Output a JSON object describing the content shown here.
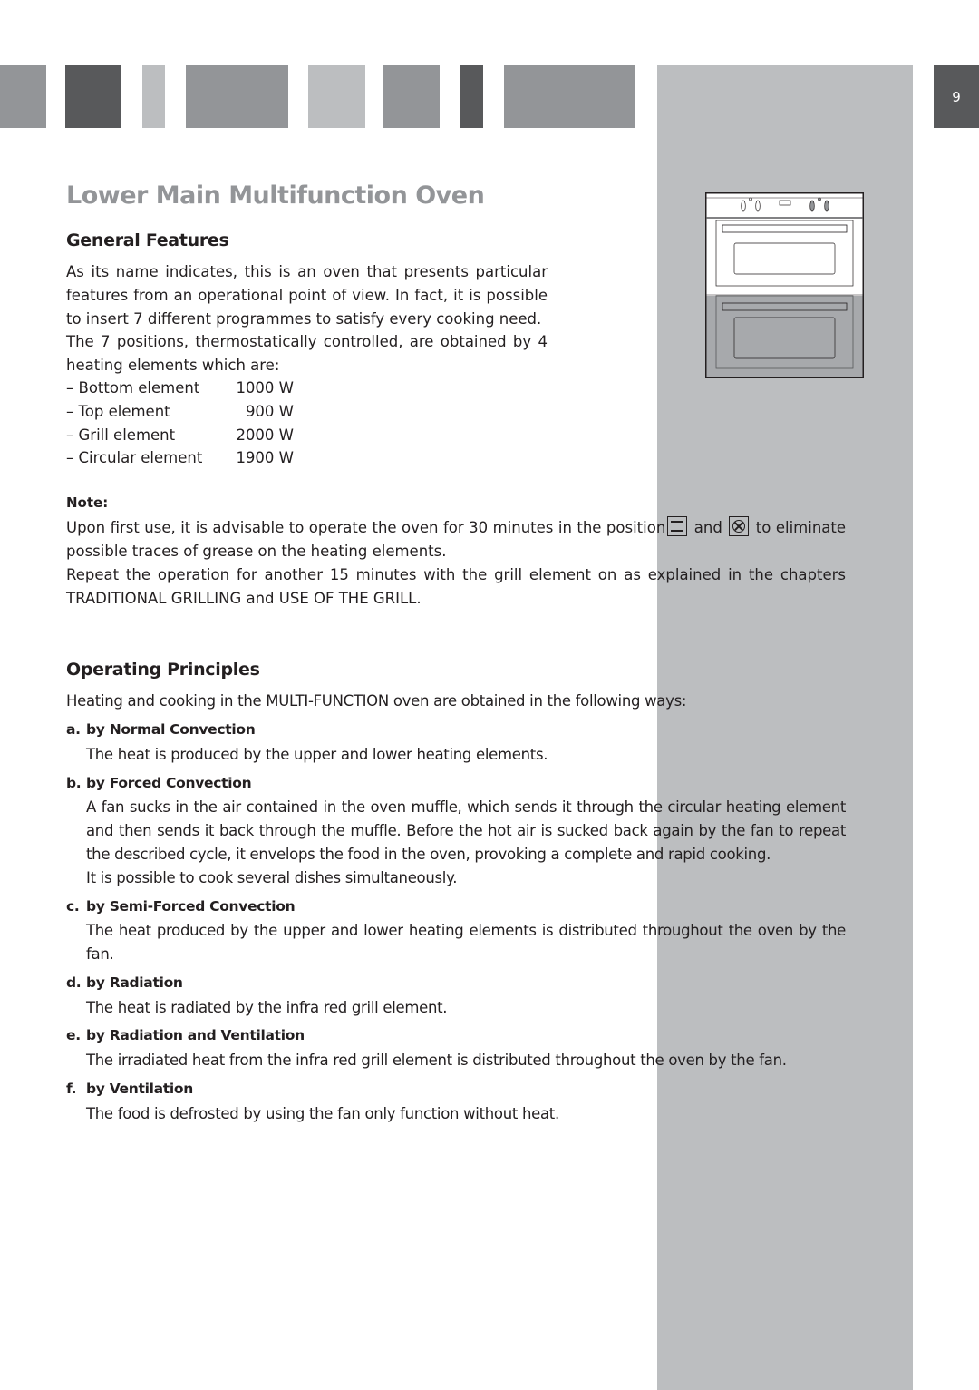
{
  "header": {
    "page_number": "9",
    "blocks": [
      {
        "name": "header-block-1",
        "tone": "mid"
      },
      {
        "name": "header-block-2",
        "tone": "dark"
      },
      {
        "name": "header-block-3",
        "tone": "light"
      },
      {
        "name": "header-block-4",
        "tone": "mid"
      },
      {
        "name": "header-block-5",
        "tone": "light"
      },
      {
        "name": "header-block-6",
        "tone": "mid"
      },
      {
        "name": "header-block-7",
        "tone": "dark"
      },
      {
        "name": "header-block-8",
        "tone": "mid"
      }
    ]
  },
  "colors": {
    "title_gray": "#939598",
    "dark_gray": "#58595b",
    "light_gray": "#bcbec0",
    "text": "#231f20"
  },
  "page": {
    "title": "Lower Main Multifunction Oven",
    "general_features": {
      "heading": "General Features",
      "intro_1": "As its name indicates, this is an oven that presents particular features from an operational point of view. In fact, it is possible to insert 7 different programmes to satisfy every cooking need.",
      "intro_2": "The 7 positions, thermostatically controlled, are obtained by 4 heating elements which are:",
      "elements": [
        {
          "name": "– Bottom element",
          "power": "1000 W"
        },
        {
          "name": "– Top element",
          "power": "900 W"
        },
        {
          "name": "– Grill element",
          "power": "2000 W"
        },
        {
          "name": "– Circular element",
          "power": "1900 W"
        }
      ]
    },
    "note": {
      "label": "Note:",
      "text_before_icons": "Upon first use, it is advisable to operate the oven for 30 minutes in the position",
      "icon_1": "top-bottom-heat-icon",
      "and": "and",
      "icon_2": "fan-icon",
      "text_after_icons": "to eliminate possible traces of grease on the heating elements.",
      "repeat": "Repeat the operation for another 15 minutes with the grill element on as explained in the chapters TRADITIONAL GRILLING and USE OF THE GRILL."
    },
    "operating_principles": {
      "heading": "Operating Principles",
      "intro": "Heating and cooking in the MULTI-FUNCTION oven are obtained in the following ways:",
      "methods": [
        {
          "letter": "a.",
          "title": "by Normal Convection",
          "body": [
            "The heat is produced by the upper and lower heating elements."
          ]
        },
        {
          "letter": "b.",
          "title": "by Forced Convection",
          "body": [
            "A fan sucks in the air contained in the oven muffle, which sends it through the circular heating element and then sends it back through the muffle. Before the hot air is sucked back again by the fan to repeat the described cycle, it envelops the food in the oven, provoking a complete and rapid cooking.",
            "It is possible to cook several dishes simultaneously."
          ]
        },
        {
          "letter": "c.",
          "title": "by Semi-Forced Convection",
          "body": [
            "The heat produced by the upper and lower heating elements is distributed throughout the oven by the fan."
          ]
        },
        {
          "letter": "d.",
          "title": "by Radiation",
          "body": [
            "The heat is radiated by the infra red grill  element."
          ]
        },
        {
          "letter": "e.",
          "title": "by Radiation and Ventilation",
          "body": [
            "The irradiated heat from the infra red grill element is distributed throughout the oven by the fan."
          ]
        },
        {
          "letter": "f.",
          "title": "by Ventilation",
          "body": [
            "The food is defrosted by using the fan only function without heat."
          ]
        }
      ]
    }
  }
}
